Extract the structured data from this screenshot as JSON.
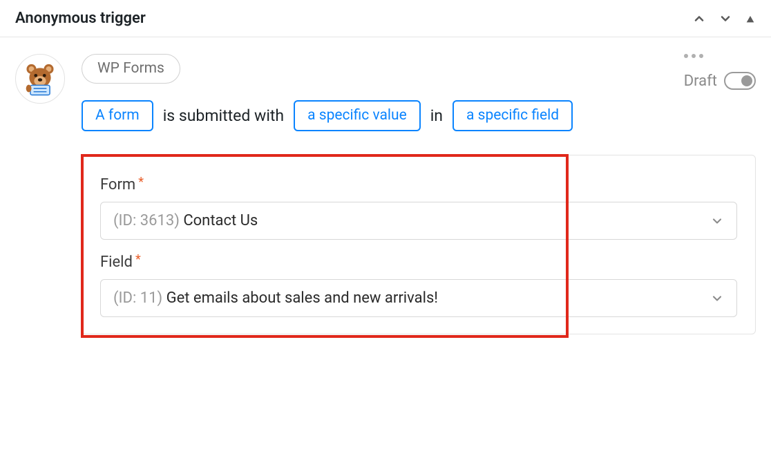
{
  "header": {
    "title": "Anonymous trigger"
  },
  "integration": {
    "name": "WP Forms"
  },
  "sentence": {
    "form_token": "A form",
    "mid1": "is submitted with",
    "value_token": "a specific value",
    "mid2": "in",
    "field_token": "a specific field"
  },
  "status": {
    "label": "Draft"
  },
  "fields": {
    "form": {
      "label": "Form",
      "id_prefix": "(ID: 3613) ",
      "name": "Contact Us"
    },
    "field": {
      "label": "Field",
      "id_prefix": "(ID: 11) ",
      "name": "Get emails about sales and new arrivals!"
    }
  }
}
